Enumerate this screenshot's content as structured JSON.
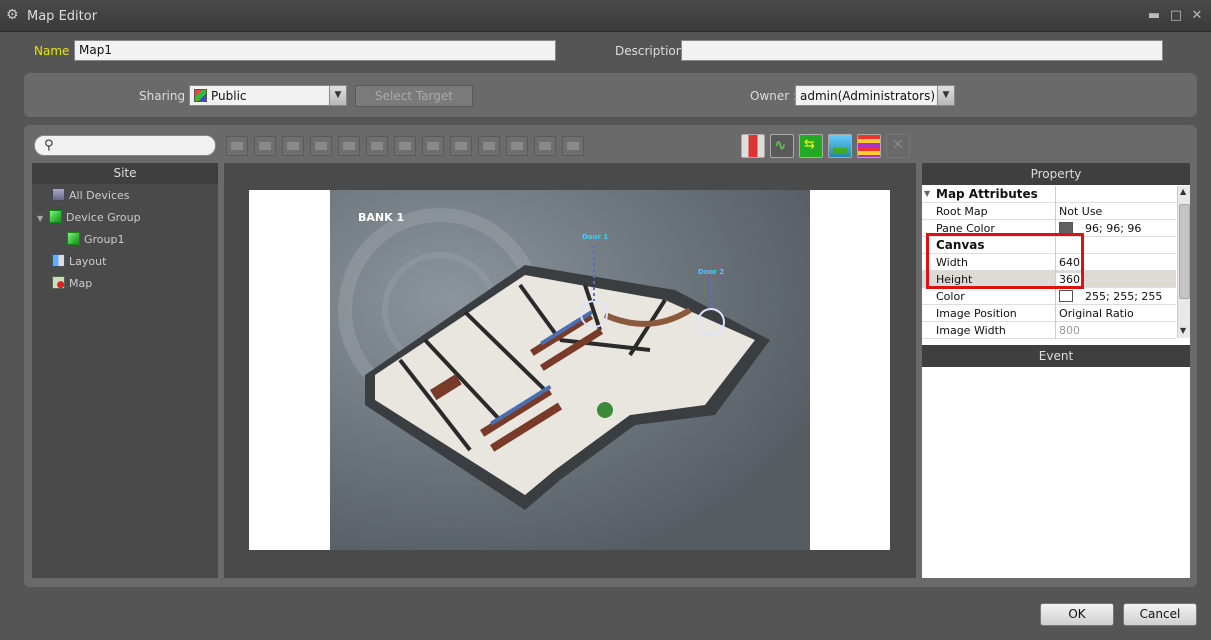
{
  "window": {
    "title": "Map Editor",
    "controls": {
      "minimize": "▬",
      "maximize": "□",
      "close": "✕"
    }
  },
  "form": {
    "name_label": "Name :",
    "name_value": "Map1",
    "description_label": "Description :",
    "description_value": "",
    "sharing_label": "Sharing :",
    "sharing_value": "Public",
    "select_target_label": "Select Target",
    "owner_label": "Owner :",
    "owner_value": "admin(Administrators)"
  },
  "toolbar": {
    "align_buttons": [
      "align-top",
      "align-center-vertical",
      "align-bottom",
      "align-left",
      "align-center-horizontal",
      "align-right",
      "distribute-horizontal",
      "distribute-vertical",
      "same-width",
      "same-height",
      "same-size",
      "snap"
    ],
    "color_buttons": [
      {
        "name": "layer-split",
        "color": "#d33"
      },
      {
        "name": "graph",
        "color": "#4a4"
      },
      {
        "name": "swap",
        "color": "#2a2"
      },
      {
        "name": "image",
        "color": "#39c"
      },
      {
        "name": "stack",
        "color": "#c4a"
      },
      {
        "name": "delete",
        "color": "#777"
      }
    ]
  },
  "site": {
    "header": "Site",
    "items": [
      {
        "label": "All Devices",
        "icon": "devices-icon"
      },
      {
        "label": "Device Group",
        "icon": "cube-icon"
      },
      {
        "label": "Group1",
        "icon": "cube-icon"
      },
      {
        "label": "Layout",
        "icon": "layout-icon"
      },
      {
        "label": "Map",
        "icon": "map-icon"
      }
    ]
  },
  "map": {
    "title": "BANK 1",
    "door1": "Door 1",
    "door2": "Door 2"
  },
  "property": {
    "header": "Property",
    "rows": [
      {
        "key": "Map Attributes",
        "value": ""
      },
      {
        "key": "Root Map",
        "value": "Not Use"
      },
      {
        "key": "Pane Color",
        "value": "96; 96; 96",
        "swatch": "#606060"
      },
      {
        "key": "Canvas",
        "value": ""
      },
      {
        "key": "Width",
        "value": "640"
      },
      {
        "key": "Height",
        "value": "360"
      },
      {
        "key": "Color",
        "value": "255; 255; 255",
        "swatch": "#ffffff"
      },
      {
        "key": "Image Position",
        "value": "Original Ratio"
      },
      {
        "key": "Image Width",
        "value": "800"
      }
    ],
    "event_header": "Event"
  },
  "footer": {
    "ok_label": "OK",
    "cancel_label": "Cancel"
  }
}
